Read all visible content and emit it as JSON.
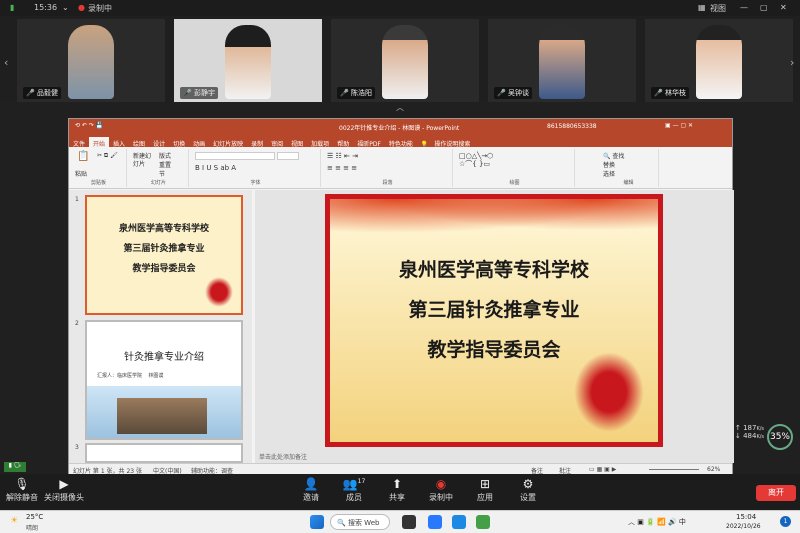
{
  "topbar": {
    "time": "15:36",
    "recording": "录制中",
    "view_label": "视图"
  },
  "gallery": {
    "participants": [
      {
        "name": "品毅健"
      },
      {
        "name": "彭静宇"
      },
      {
        "name": "陈浩阳"
      },
      {
        "name": "吴钟谈"
      },
      {
        "name": "林华枝"
      }
    ]
  },
  "ppt": {
    "title": "0022年针推专业介绍 - 林图谟 - PowerPoint",
    "account": "8615880653338",
    "tabs": [
      "文件",
      "开始",
      "插入",
      "绘图",
      "设计",
      "切换",
      "动画",
      "幻灯片放映",
      "录制",
      "审阅",
      "视图",
      "加载项",
      "帮助",
      "福昕PDF",
      "特色功能",
      "操作说明搜索"
    ],
    "active_tab": "开始",
    "ribbon_groups": [
      "剪贴板",
      "幻灯片",
      "字体",
      "段落",
      "绘图",
      "编辑"
    ],
    "ribbon_buttons": {
      "paste": "粘贴",
      "new_slide": "新建幻灯片",
      "layout": "版式",
      "reset": "重置",
      "section": "节",
      "find": "查找",
      "replace": "替换",
      "select": "选择"
    },
    "slides": [
      {
        "num": "1",
        "lines": [
          "泉州医学高等专科学校",
          "第三届针灸推拿专业",
          "教学指导委员会"
        ]
      },
      {
        "num": "2",
        "title": "针灸推拿专业介绍",
        "reporter": "汇报人：临床医学院",
        "reporter_name": "林图谟"
      },
      {
        "num": "3"
      }
    ],
    "main_slide": {
      "lines": [
        "泉州医学高等专科学校",
        "第三届针灸推拿专业",
        "教学指导委员会"
      ]
    },
    "notes_placeholder": "单击此处添加备注",
    "status": {
      "slide_info": "幻灯片 第 1 张，共 23 张",
      "lang": "中文(中国)",
      "accessibility": "辅助功能：调查",
      "notes": "备注",
      "comments": "批注",
      "zoom": "62%"
    }
  },
  "net": {
    "up": "187",
    "down": "484",
    "unit": "K/s",
    "percent": "35%"
  },
  "toolbar": {
    "mute": "解除静音",
    "video": "关闭摄像头",
    "invite": "邀请",
    "members": "成员",
    "members_count": "17",
    "share": "共享",
    "record": "录制中",
    "apps": "应用",
    "settings": "设置",
    "leave": "离开"
  },
  "taskbar": {
    "weather_temp": "25°C",
    "weather_desc": "晴朗",
    "search": "搜索 Web",
    "time": "15:04",
    "date": "2022/10/26"
  }
}
